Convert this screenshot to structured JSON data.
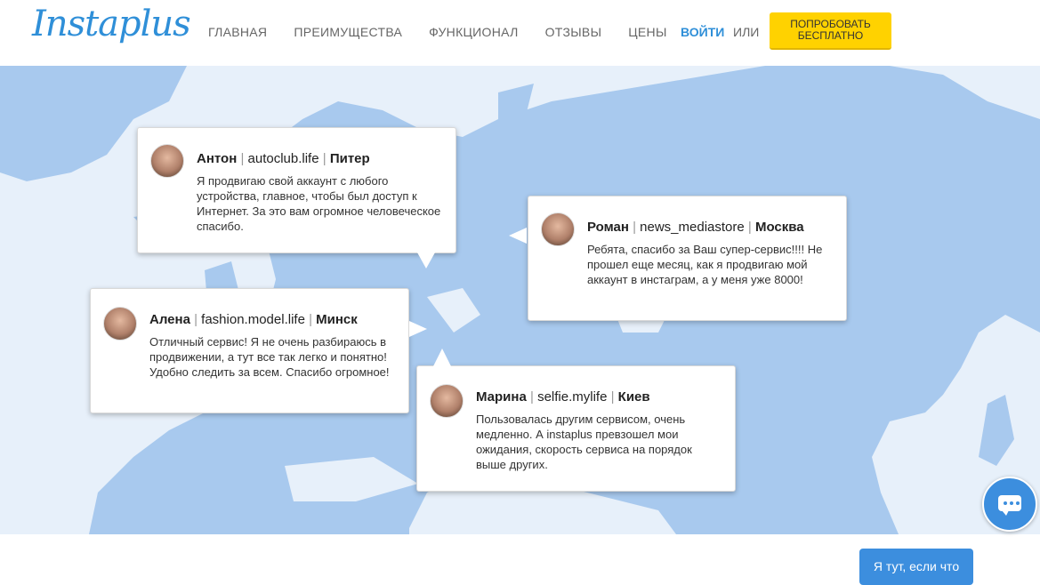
{
  "header": {
    "logo": "Instaplus",
    "nav": [
      "ГЛАВНАЯ",
      "ПРЕИМУЩЕСТВА",
      "ФУНКЦИОНАЛ",
      "ОТЗЫВЫ",
      "ЦЕНЫ"
    ],
    "login": "ВОЙТИ",
    "or": "ИЛИ",
    "try_line1": "ПОПРОБОВАТЬ",
    "try_line2": "БЕСПЛАТНО"
  },
  "reviews": [
    {
      "name": "Антон",
      "site": "autoclub.life",
      "city": "Питер",
      "text": "Я продвигаю свой аккаунт с любого устройства, главное, чтобы был доступ к Интернет. За это вам огромное человеческое спасибо."
    },
    {
      "name": "Роман",
      "site": "news_mediastore",
      "city": "Москва",
      "text": "Ребята, спасибо за Ваш супер-сервис!!!! Не прошел еще месяц, как я продвигаю мой аккаунт в инстаграм, а у меня уже 8000!"
    },
    {
      "name": "Алена",
      "site": "fashion.model.life",
      "city": "Минск",
      "text": "Отличный сервис! Я не очень разбираюсь в продвижении, а тут все так легко и понятно! Удобно следить за всем. Спасибо огромное!"
    },
    {
      "name": "Марина",
      "site": "selfie.mylife",
      "city": "Киев",
      "text": "Пользовалась другим сервисом, очень медленно. А instaplus превзошел мои ожидания, скорость сервиса на порядок выше других."
    }
  ],
  "chat": {
    "label": "Я тут, если что",
    "icon": "chat-bubble-icon"
  },
  "colors": {
    "brand": "#2f8fd8",
    "accent": "#ffd200",
    "land": "#a8c9ee",
    "sea": "#e7f0fa"
  }
}
